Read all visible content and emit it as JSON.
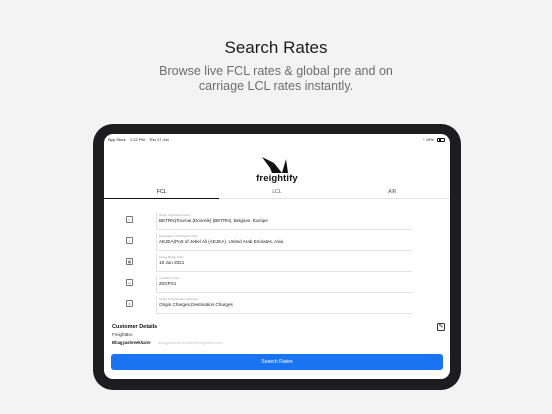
{
  "promo": {
    "title": "Search Rates",
    "subtitle": "Browse live FCL rates & global pre and on carriage LCL rates instantly."
  },
  "status_bar": {
    "carrier": "App Store",
    "time": "1:22 PM",
    "date": "Thu 17 Jun",
    "battery": "19%"
  },
  "app": {
    "brand": "freightify",
    "tabs": [
      {
        "label": "FCL",
        "active": true
      },
      {
        "label": "LCL",
        "active": false
      },
      {
        "label": "AIR",
        "active": false
      }
    ],
    "form": [
      {
        "icon": "origin-pin-icon",
        "label": "Origin City/Port/Country",
        "value": "BETRN(Tournai (Doornik) (BETRN), Belgium, Europe"
      },
      {
        "icon": "destination-pin-icon",
        "label": "Destination City/Port/Country",
        "value": "AEJEA(Port of Jebel Ali (AEJEA), United Arab Emirates, Asia"
      },
      {
        "icon": "calendar-icon",
        "label": "Cargo Ready Date",
        "value": "18 Jun 2021"
      },
      {
        "icon": "container-icon",
        "label": "Container Type",
        "value": "20GPX1"
      },
      {
        "icon": "charges-icon",
        "label": "Origin & Destination Charges",
        "value": "Origin Charges,Destination Charges"
      }
    ],
    "customer": {
      "title": "Customer Details",
      "company": "FreightBro",
      "contact_name": "Bhagyashreekhaire",
      "contact_email": "bhagyashree.khaire@freightbro.com"
    },
    "search_button": "Search Rates"
  },
  "colors": {
    "primary": "#1a73f0",
    "device_frame": "#1d1d1f",
    "background": "#f3f3f3"
  }
}
